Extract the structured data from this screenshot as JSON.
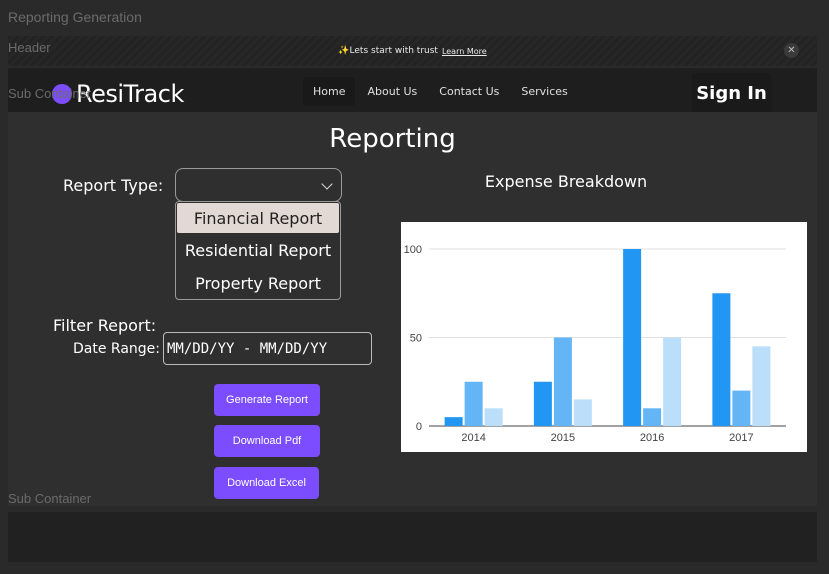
{
  "frame": {
    "top_label": "Reporting Generation",
    "header_label": "Header",
    "sub_container_label": "Sub Container"
  },
  "banner": {
    "text": "✨Lets start with trust",
    "link": "Learn More",
    "close_icon": "close-icon"
  },
  "nav": {
    "brand": "ResiTrack",
    "links": [
      "Home",
      "About Us",
      "Contact Us",
      "Services"
    ],
    "active": "Home",
    "sign_in": "Sign In"
  },
  "page": {
    "title": "Reporting"
  },
  "form": {
    "report_type_label": "Report Type:",
    "report_type_value": "",
    "options": [
      "Financial Report",
      "Residential Report",
      "Property Report"
    ],
    "highlighted_option": "Financial Report",
    "filter_label": "Filter Report:",
    "date_range_label": "Date Range:",
    "date_range_placeholder": "MM/DD/YY - MM/DD/YY"
  },
  "actions": {
    "generate": "Generate Report",
    "pdf": "Download Pdf",
    "excel": "Download Excel"
  },
  "chart_data": {
    "type": "bar",
    "title": "Expense Breakdown",
    "categories": [
      "2014",
      "2015",
      "2016",
      "2017"
    ],
    "series": [
      {
        "values": [
          5,
          25,
          100,
          75
        ],
        "color": "#2196f3"
      },
      {
        "values": [
          25,
          50,
          10,
          20
        ],
        "color": "#64b5f6"
      },
      {
        "values": [
          10,
          15,
          50,
          45
        ],
        "color": "#bbdefb"
      }
    ],
    "yticks": [
      0,
      50,
      100
    ],
    "ylim": [
      0,
      100
    ],
    "grid": true
  },
  "colors": {
    "accent": "#7c4dff"
  }
}
